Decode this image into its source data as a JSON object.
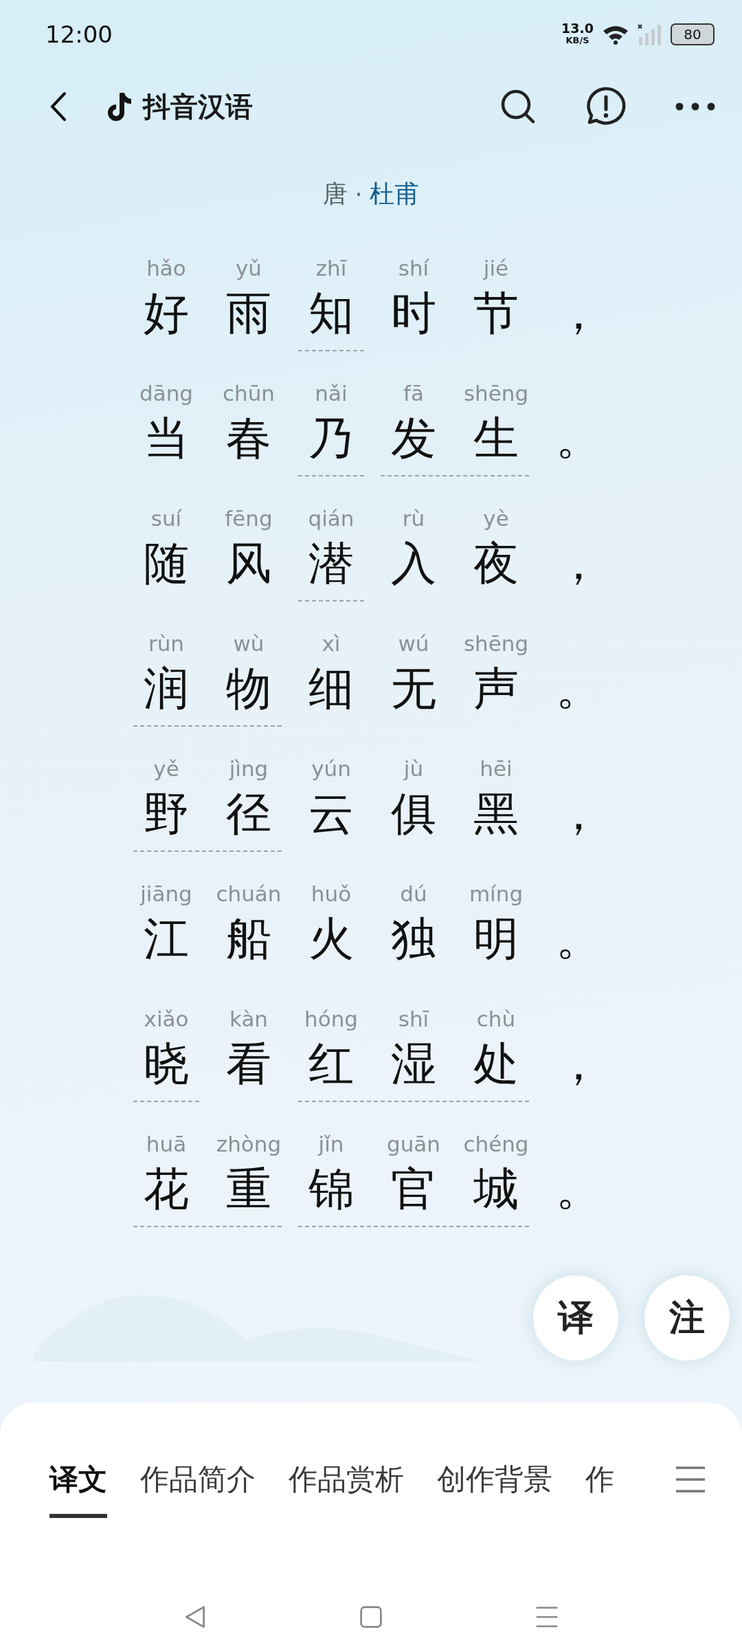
{
  "status_bar": {
    "time": "12:00",
    "net_speed": "13.0",
    "net_unit": "KB/S",
    "battery": "80"
  },
  "app_bar": {
    "title": "抖音汉语"
  },
  "poem": {
    "dynasty": "唐",
    "separator": "·",
    "author": "杜甫",
    "lines": [
      {
        "punct": "，",
        "words": [
          {
            "annotated": false,
            "chars": [
              {
                "hanzi": "好",
                "pinyin": "hǎo"
              },
              {
                "hanzi": "雨",
                "pinyin": "yǔ"
              }
            ]
          },
          {
            "annotated": true,
            "chars": [
              {
                "hanzi": "知",
                "pinyin": "zhī"
              }
            ]
          },
          {
            "annotated": false,
            "chars": [
              {
                "hanzi": "时",
                "pinyin": "shí"
              },
              {
                "hanzi": "节",
                "pinyin": "jié"
              }
            ]
          }
        ]
      },
      {
        "punct": "。",
        "words": [
          {
            "annotated": false,
            "chars": [
              {
                "hanzi": "当",
                "pinyin": "dāng"
              },
              {
                "hanzi": "春",
                "pinyin": "chūn"
              }
            ]
          },
          {
            "annotated": true,
            "chars": [
              {
                "hanzi": "乃",
                "pinyin": "nǎi"
              }
            ]
          },
          {
            "annotated": true,
            "chars": [
              {
                "hanzi": "发",
                "pinyin": "fā"
              },
              {
                "hanzi": "生",
                "pinyin": "shēng"
              }
            ]
          }
        ]
      },
      {
        "punct": "，",
        "words": [
          {
            "annotated": false,
            "chars": [
              {
                "hanzi": "随",
                "pinyin": "suí"
              },
              {
                "hanzi": "风",
                "pinyin": "fēng"
              }
            ]
          },
          {
            "annotated": true,
            "chars": [
              {
                "hanzi": "潜",
                "pinyin": "qián"
              }
            ]
          },
          {
            "annotated": false,
            "chars": [
              {
                "hanzi": "入",
                "pinyin": "rù"
              },
              {
                "hanzi": "夜",
                "pinyin": "yè"
              }
            ]
          }
        ]
      },
      {
        "punct": "。",
        "words": [
          {
            "annotated": true,
            "chars": [
              {
                "hanzi": "润",
                "pinyin": "rùn"
              },
              {
                "hanzi": "物",
                "pinyin": "wù"
              }
            ]
          },
          {
            "annotated": false,
            "chars": [
              {
                "hanzi": "细",
                "pinyin": "xì"
              },
              {
                "hanzi": "无",
                "pinyin": "wú"
              },
              {
                "hanzi": "声",
                "pinyin": "shēng"
              }
            ]
          }
        ]
      },
      {
        "punct": "，",
        "words": [
          {
            "annotated": true,
            "chars": [
              {
                "hanzi": "野",
                "pinyin": "yě"
              },
              {
                "hanzi": "径",
                "pinyin": "jìng"
              }
            ]
          },
          {
            "annotated": false,
            "chars": [
              {
                "hanzi": "云",
                "pinyin": "yún"
              },
              {
                "hanzi": "俱",
                "pinyin": "jù"
              },
              {
                "hanzi": "黑",
                "pinyin": "hēi"
              }
            ]
          }
        ]
      },
      {
        "punct": "。",
        "words": [
          {
            "annotated": false,
            "chars": [
              {
                "hanzi": "江",
                "pinyin": "jiāng"
              },
              {
                "hanzi": "船",
                "pinyin": "chuán"
              },
              {
                "hanzi": "火",
                "pinyin": "huǒ"
              },
              {
                "hanzi": "独",
                "pinyin": "dú"
              },
              {
                "hanzi": "明",
                "pinyin": "míng"
              }
            ]
          }
        ]
      },
      {
        "punct": "，",
        "words": [
          {
            "annotated": true,
            "chars": [
              {
                "hanzi": "晓",
                "pinyin": "xiǎo"
              }
            ]
          },
          {
            "annotated": false,
            "chars": [
              {
                "hanzi": "看",
                "pinyin": "kàn"
              }
            ]
          },
          {
            "annotated": true,
            "chars": [
              {
                "hanzi": "红",
                "pinyin": "hóng"
              },
              {
                "hanzi": "湿",
                "pinyin": "shī"
              },
              {
                "hanzi": "处",
                "pinyin": "chù"
              }
            ]
          }
        ]
      },
      {
        "punct": "。",
        "words": [
          {
            "annotated": true,
            "chars": [
              {
                "hanzi": "花",
                "pinyin": "huā"
              },
              {
                "hanzi": "重",
                "pinyin": "zhòng"
              }
            ]
          },
          {
            "annotated": true,
            "chars": [
              {
                "hanzi": "锦",
                "pinyin": "jǐn"
              },
              {
                "hanzi": "官",
                "pinyin": "guān"
              },
              {
                "hanzi": "城",
                "pinyin": "chéng"
              }
            ]
          }
        ]
      }
    ]
  },
  "float_buttons": [
    "译",
    "注"
  ],
  "tabs": [
    {
      "label": "译文",
      "selected": true
    },
    {
      "label": "作品简介",
      "selected": false
    },
    {
      "label": "作品赏析",
      "selected": false
    },
    {
      "label": "创作背景",
      "selected": false
    },
    {
      "label": "作",
      "selected": false
    }
  ]
}
